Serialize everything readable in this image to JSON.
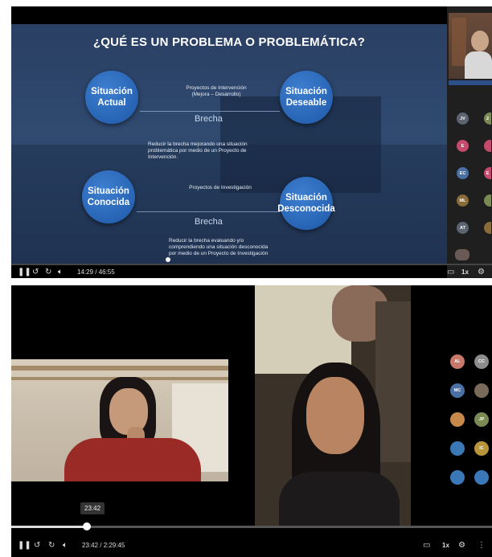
{
  "top_player": {
    "slide": {
      "title": "¿QUÉ ES UN PROBLEMA O PROBLEMÁTICA?",
      "circles": {
        "actual": "Situación\nActual",
        "deseable": "Situación\nDeseable",
        "conocida": "Situación\nConocida",
        "desconocida": "Situación\nDesconocida"
      },
      "label_intervencion": "Proyectos de Intervención\n(Mejora – Desarrollo)",
      "brecha_1": "Brecha",
      "reducir_1": "Reducir la brecha mejorando una situación\nproblemática por medio de un Proyecto de\nIntervención.",
      "label_investigacion": "Proyectos de Investigación",
      "brecha_2": "Brecha",
      "reducir_2": "Reducir la brecha evaluando y/o\ncomprendiendo una situación desconocida\npor medio de un Proyecto de Investigación"
    },
    "participants": [
      "JV",
      "E",
      "EC",
      "ML",
      "AT"
    ],
    "participants_partial": [
      "2",
      "",
      "E",
      "",
      ""
    ],
    "time": "14:29 / 46:55",
    "speed": "1x"
  },
  "bottom_player": {
    "participants": [
      "AL",
      "CC",
      "MC",
      "",
      "",
      "JP",
      "",
      "IC",
      "",
      ""
    ],
    "tooltip_time": "23:42",
    "time": "23:42 / 2:29:45",
    "progress": 0.158,
    "speed": "1x"
  },
  "colors": {
    "slide_bg": "#2a3f63",
    "circle_blue": "#2a6bc0",
    "avatar_colors": [
      "#5b6470",
      "#c54b6c",
      "#4a6fa5",
      "#8a6b3a",
      "#7a8a55"
    ]
  }
}
